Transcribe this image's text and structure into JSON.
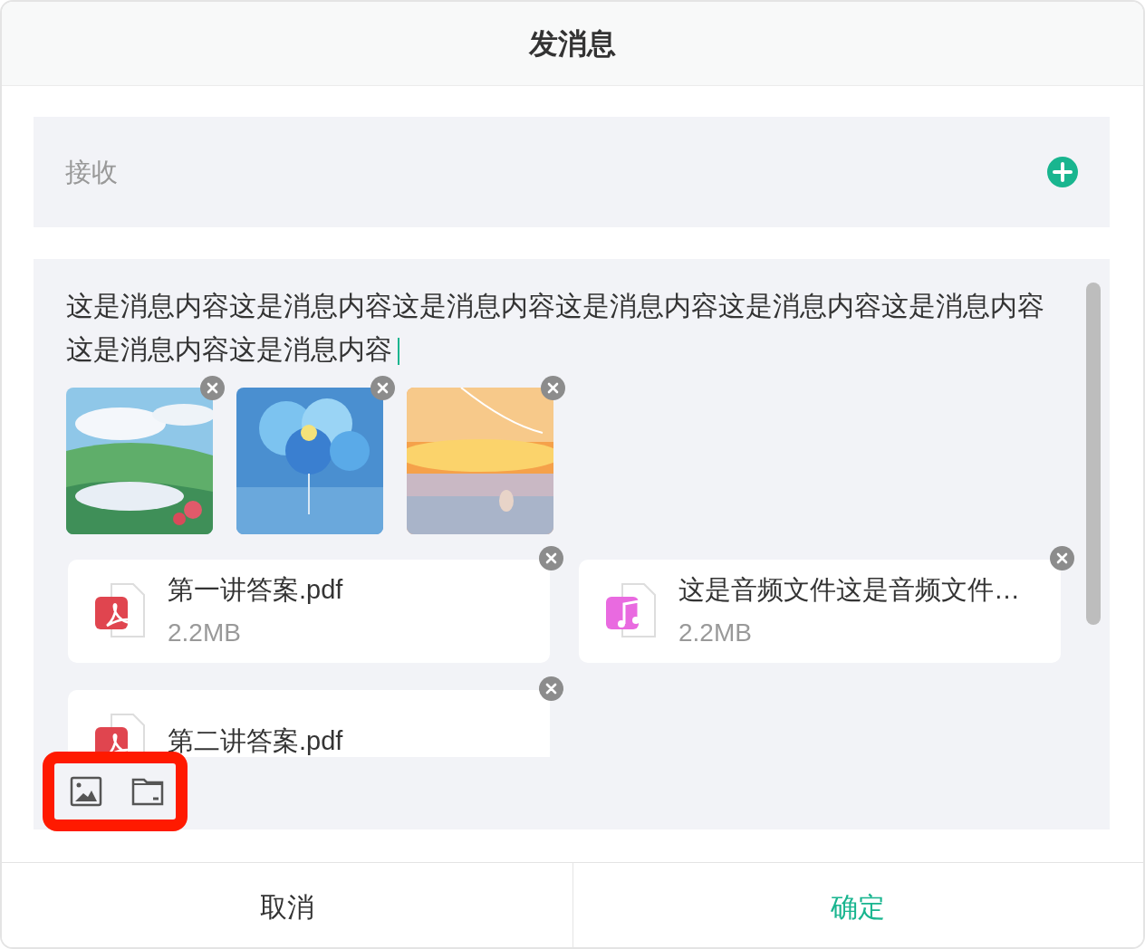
{
  "dialog": {
    "title": "发消息"
  },
  "recipient": {
    "placeholder": "接收"
  },
  "message": {
    "text": "这是消息内容这是消息内容这是消息内容这是消息内容这是消息内容这是消息内容这是消息内容这是消息内容",
    "focused": true
  },
  "files": [
    {
      "kind": "pdf",
      "name": "第一讲答案.pdf",
      "size": "2.2MB"
    },
    {
      "kind": "audio",
      "name": "这是音频文件这是音频文件…",
      "size": "2.2MB"
    },
    {
      "kind": "pdf",
      "name": "第二讲答案.pdf"
    }
  ],
  "toolbar": {
    "highlighted": true
  },
  "buttons": [
    {
      "label": "取消",
      "primary": false
    },
    {
      "label": "确定",
      "primary": true
    }
  ]
}
